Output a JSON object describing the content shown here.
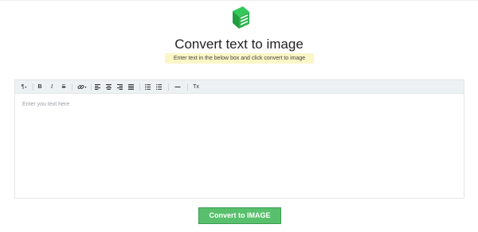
{
  "header": {
    "logo_icon": "green-document-logo-icon",
    "title": "Convert text to image",
    "subtitle": "Enter text in the below box and click convert to image"
  },
  "editor": {
    "toolbar": {
      "paragraph": "¶",
      "bold": "B",
      "italic": "I",
      "strikethrough": "S",
      "link_icon": "link-icon",
      "align_left_icon": "align-left-icon",
      "align_center_icon": "align-center-icon",
      "align_right_icon": "align-right-icon",
      "align_justify_icon": "align-justify-icon",
      "bullet_list_icon": "bullet-list-icon",
      "ordered_list_icon": "ordered-list-icon",
      "horizontal_rule_icon": "horizontal-rule-icon",
      "clear_format_label": "Tx"
    },
    "placeholder": "Enter you text here"
  },
  "actions": {
    "convert_label": "Convert to IMAGE"
  },
  "colors": {
    "accent_green": "#58c06c",
    "subtitle_highlight": "#fbf6c6",
    "toolbar_bg": "#edf1f3"
  }
}
